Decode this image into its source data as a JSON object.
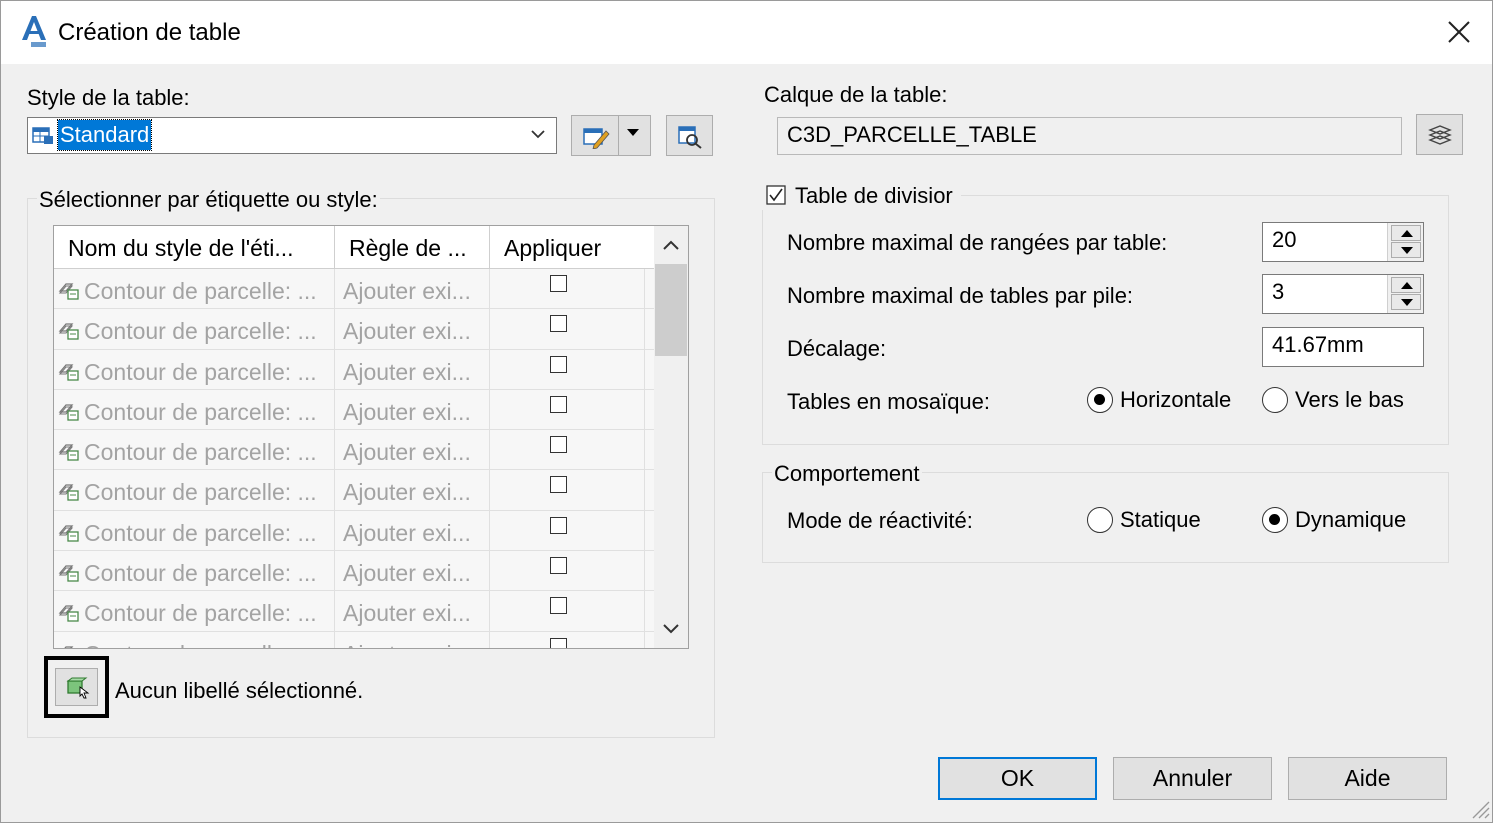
{
  "window": {
    "title": "Création de table"
  },
  "table_style": {
    "label": "Style de la table:",
    "value": "Standard"
  },
  "layer": {
    "label": "Calque de la table:",
    "value": "C3D_PARCELLE_TABLE"
  },
  "select_group": {
    "label": "Sélectionner par étiquette ou style:",
    "columns": [
      "Nom du style de l'éti...",
      "Règle de ...",
      "Appliquer"
    ],
    "rows": [
      {
        "name": "Contour de parcelle: ...",
        "rule": "Ajouter exi...",
        "apply": false
      },
      {
        "name": "Contour de parcelle: ...",
        "rule": "Ajouter exi...",
        "apply": false
      },
      {
        "name": "Contour de parcelle: ...",
        "rule": "Ajouter exi...",
        "apply": false
      },
      {
        "name": "Contour de parcelle: ...",
        "rule": "Ajouter exi...",
        "apply": false
      },
      {
        "name": "Contour de parcelle: ...",
        "rule": "Ajouter exi...",
        "apply": false
      },
      {
        "name": "Contour de parcelle: ...",
        "rule": "Ajouter exi...",
        "apply": false
      },
      {
        "name": "Contour de parcelle: ...",
        "rule": "Ajouter exi...",
        "apply": false
      },
      {
        "name": "Contour de parcelle: ...",
        "rule": "Ajouter exi...",
        "apply": false
      },
      {
        "name": "Contour de parcelle: ...",
        "rule": "Ajouter exi...",
        "apply": false
      },
      {
        "name": "Contour de parcelle: ...",
        "rule": "Ajouter exi...",
        "apply": false
      }
    ],
    "status": "Aucun libellé sélectionné."
  },
  "split": {
    "checkbox_label": "Table de divisior",
    "checked": true,
    "max_rows_label": "Nombre maximal de rangées par table:",
    "max_rows_value": "20",
    "max_tables_label": "Nombre maximal de tables par pile:",
    "max_tables_value": "3",
    "offset_label": "Décalage:",
    "offset_value": "41.67mm",
    "tile_label": "Tables en mosaïque:",
    "tile_horizontal": "Horizontale",
    "tile_down": "Vers le bas",
    "tile_selected": "Horizontale"
  },
  "behavior": {
    "group_label": "Comportement",
    "mode_label": "Mode de réactivité:",
    "static": "Statique",
    "dynamic": "Dynamique",
    "selected": "Dynamique"
  },
  "buttons": {
    "ok": "OK",
    "cancel": "Annuler",
    "help": "Aide"
  },
  "colors": {
    "accent": "#0078d7",
    "window_bg": "#f0f0f0",
    "disabled_text": "#a3a3a3"
  }
}
